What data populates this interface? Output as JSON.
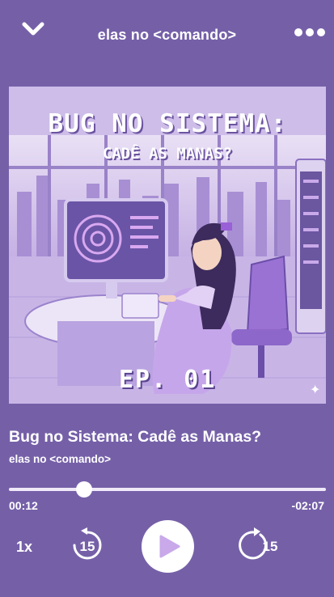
{
  "header": {
    "title": "elas no <comando>",
    "collapse_icon": "chevron-down-icon",
    "more_icon": "more-horizontal-icon"
  },
  "artwork": {
    "title_line1": "BUG NO SISTEMA:",
    "title_line2": "CADÊ AS MANAS?",
    "episode": "EP. 01"
  },
  "track": {
    "title": "Bug no Sistema: Cadê as Manas?",
    "artist": "elas no <comando>"
  },
  "playback": {
    "elapsed": "00:12",
    "remaining": "-02:07",
    "progress_fraction": 0.237
  },
  "controls": {
    "speed_label": "1x",
    "rewind_seconds": "15",
    "forward_seconds": "15",
    "play_icon": "play-icon",
    "rewind_icon": "rewind-15-icon",
    "forward_icon": "forward-15-icon"
  },
  "colors": {
    "background": "#7560a8",
    "accent": "#c9a9e9",
    "text": "#ffffff"
  }
}
